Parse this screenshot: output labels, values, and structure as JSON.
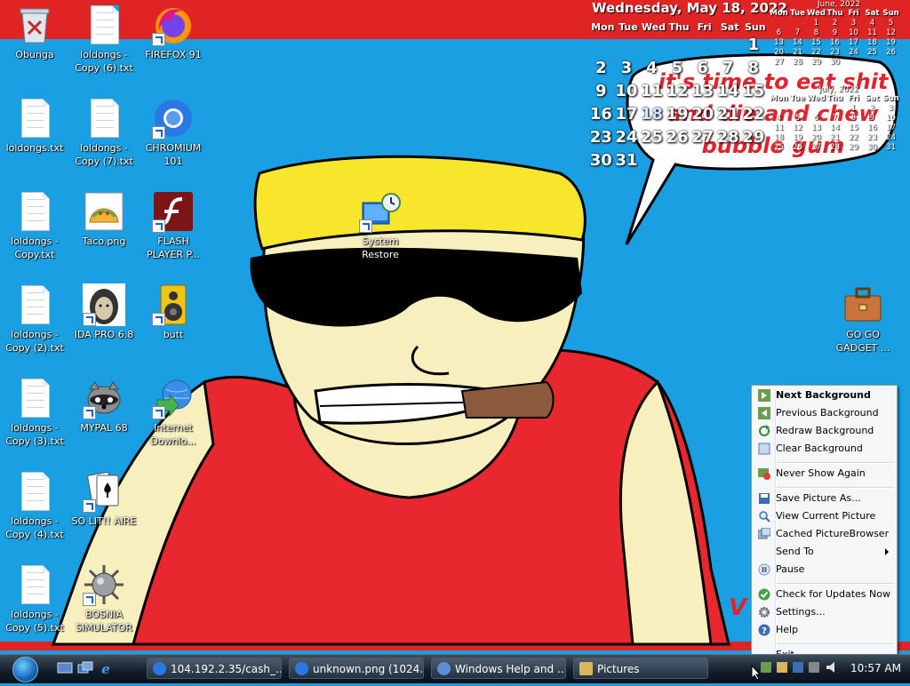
{
  "calendar": {
    "full_date": "Wednesday, May 18, 2022",
    "weekdays": [
      "Mon",
      "Tue",
      "Wed",
      "Thu",
      "Fri",
      "Sat",
      "Sun"
    ],
    "weeks": [
      [
        "",
        "",
        "",
        "",
        "",
        "",
        "1"
      ],
      [
        "2",
        "3",
        "4",
        "5",
        "6",
        "7",
        "8"
      ],
      [
        "9",
        "10",
        "11",
        "12",
        "13",
        "14",
        "15"
      ],
      [
        "16",
        "17",
        "18",
        "19",
        "20",
        "21",
        "22"
      ],
      [
        "23",
        "24",
        "25",
        "26",
        "27",
        "28",
        "29"
      ],
      [
        "30",
        "31",
        "",
        "",
        "",
        "",
        ""
      ]
    ],
    "today": "18",
    "june": {
      "title": "June, 2022",
      "weekdays": [
        "Mon",
        "Tue",
        "Wed",
        "Thu",
        "Fri",
        "Sat",
        "Sun"
      ],
      "weeks": [
        [
          "",
          "",
          "1",
          "2",
          "3",
          "4",
          "5"
        ],
        [
          "6",
          "7",
          "8",
          "9",
          "10",
          "11",
          "12"
        ],
        [
          "13",
          "14",
          "15",
          "16",
          "17",
          "18",
          "19"
        ],
        [
          "20",
          "21",
          "22",
          "23",
          "24",
          "25",
          "26"
        ],
        [
          "27",
          "28",
          "29",
          "30",
          "",
          "",
          ""
        ]
      ]
    },
    "july": {
      "title": "July, 2022",
      "weekdays": [
        "Mon",
        "Tue",
        "Wed",
        "Thu",
        "Fri",
        "Sat",
        "Sun"
      ],
      "weeks": [
        [
          "",
          "",
          "",
          "",
          "1",
          "2",
          "3"
        ],
        [
          "4",
          "5",
          "6",
          "7",
          "8",
          "9",
          "10"
        ],
        [
          "11",
          "12",
          "13",
          "14",
          "15",
          "16",
          "17"
        ],
        [
          "18",
          "19",
          "20",
          "21",
          "22",
          "23",
          "24"
        ],
        [
          "25",
          "26",
          "27",
          "28",
          "29",
          "30",
          "31"
        ]
      ]
    }
  },
  "wallpaper": {
    "speech_line1": "it's time to eat shit",
    "speech_line2": "and die and chew",
    "speech_line3": "bubble gum",
    "corner_text": "V"
  },
  "desktop_icons": {
    "obunga": "Obunga",
    "copy6": "loldongs - Copy (6).txt",
    "firefox": "FIREFOX 91",
    "loldongs": "loldongs.txt",
    "copy7": "loldongs - Copy (7).txt",
    "chromium": "CHROMIUM 101",
    "copy": "loldongs - Copy.txt",
    "taco": "Taco.png",
    "flash": "FLASH PLAYER P...",
    "restore": "System Restore",
    "copy2": "loldongs - Copy (2).txt",
    "ida": "IDA PRO 6.8",
    "butt": "butt",
    "gogo": "GO GO GADGET ...",
    "copy3": "loldongs - Copy (3).txt",
    "mypal": "MYPAL 68",
    "idm": "Internet Downlo...",
    "copy4": "loldongs - Copy (4).txt",
    "solit": "SO LIT!! AIRE",
    "copy5": "loldongs - Copy (5).txt",
    "bosnia": "BOSNIA SIMULATOR"
  },
  "context_menu": {
    "next": "Next Background",
    "previous": "Previous Background",
    "redraw": "Redraw Background",
    "clear": "Clear Background",
    "never": "Never Show Again",
    "save": "Save Picture As...",
    "view": "View Current Picture",
    "cached": "Cached PictureBrowser",
    "send": "Send To",
    "pause": "Pause",
    "updates": "Check for Updates Now",
    "settings": "Settings...",
    "help": "Help",
    "exit": "Exit"
  },
  "taskbar": {
    "task1": "104.192.2.35/cash_...",
    "task2": "unknown.png (1024...",
    "task3": "Windows Help and ...",
    "task4": "Pictures",
    "clock": "10:57 AM"
  },
  "colors": {
    "background": "#1aa0e2",
    "band": "#e02424",
    "skin": "#f7efbd",
    "shirt": "#e8282e",
    "hat": "#f7e62c"
  }
}
